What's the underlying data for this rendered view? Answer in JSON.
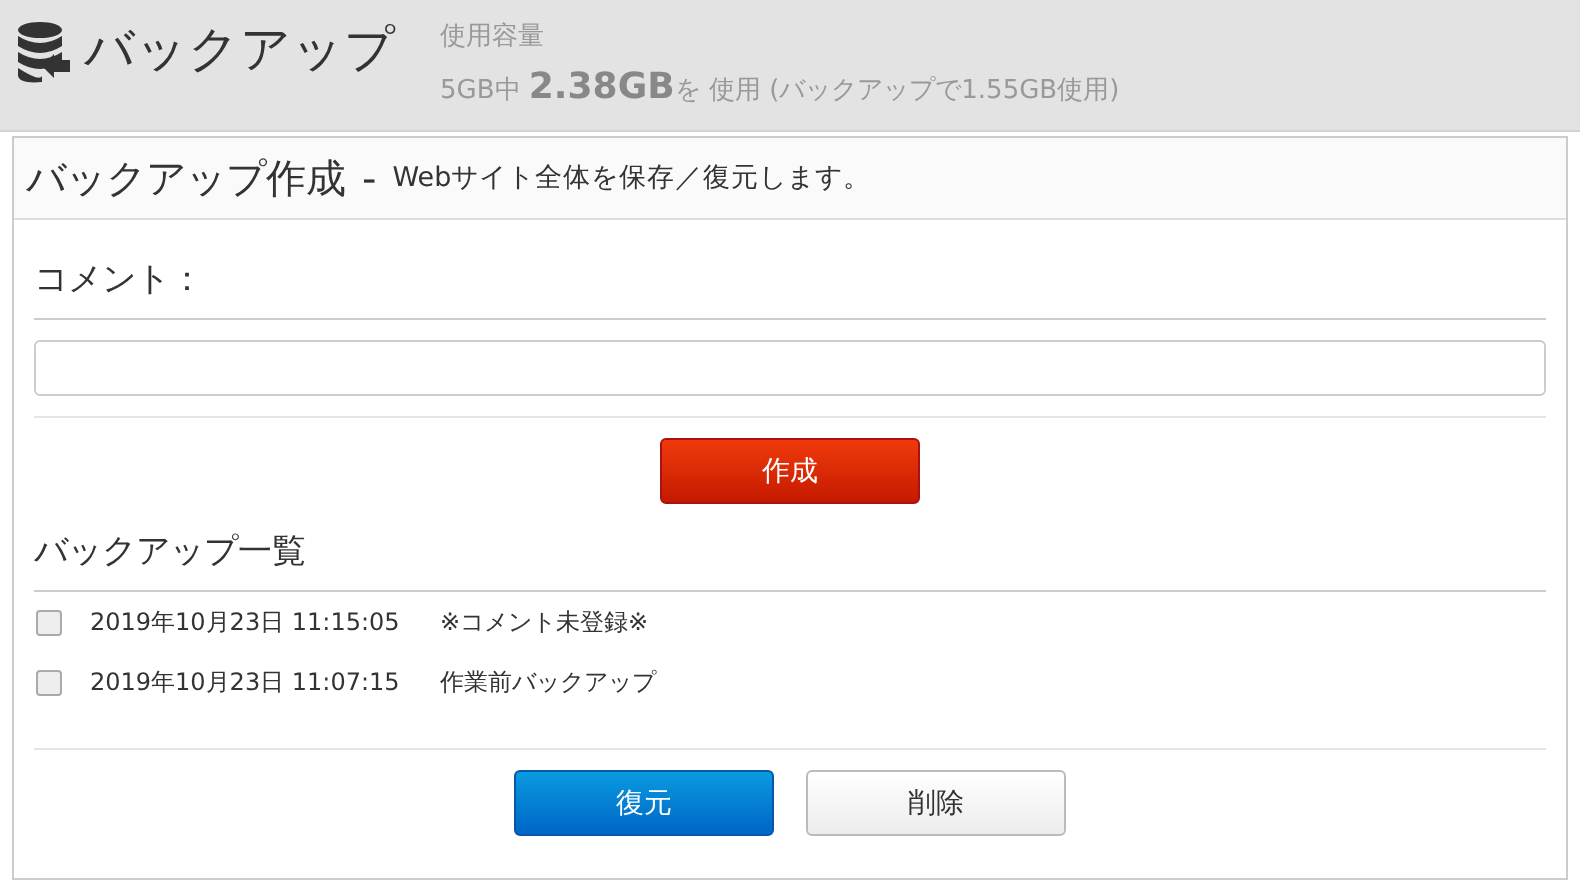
{
  "header": {
    "title": "バックアップ",
    "usage_label": "使用容量",
    "usage": "5GB中 **2.38GB**を 使用 (バックアップで1.55GB使用)"
  },
  "panel": {
    "title": "バックアップ作成",
    "separator": "-",
    "subtitle": "Webサイト全体を保存／復元します。"
  },
  "comment": {
    "label": "コメント："
  },
  "create_button": {
    "label": "作成",
    "kind": "danger"
  },
  "list": {
    "title": "バックアップ一覧",
    "rows": [
      {
        "date": "2019年10月23日 11:15:05",
        "comment": "※コメント未登録※",
        "checked": false
      },
      {
        "date": "2019年10月23日 11:07:15",
        "comment": "作業前バックアップ",
        "checked": false
      }
    ]
  },
  "buttons": [
    {
      "label": "復元",
      "kind": "primary"
    },
    {
      "label": "削除",
      "kind": "default"
    }
  ]
}
